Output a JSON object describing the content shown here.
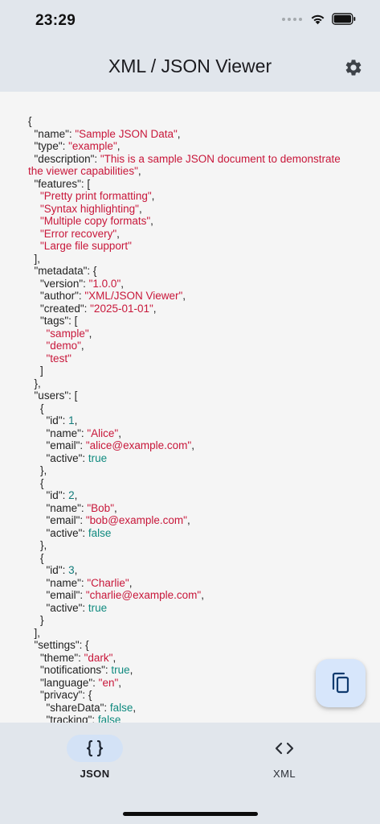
{
  "status_bar": {
    "time": "23:29"
  },
  "app_bar": {
    "title": "XML / JSON Viewer",
    "settings_icon": "gear-icon"
  },
  "json_lines": [
    [
      {
        "t": "p",
        "v": "{"
      }
    ],
    [
      {
        "t": "p",
        "v": "  \"name\": "
      },
      {
        "t": "s",
        "v": "\"Sample JSON Data\""
      },
      {
        "t": "p",
        "v": ","
      }
    ],
    [
      {
        "t": "p",
        "v": "  \"type\": "
      },
      {
        "t": "s",
        "v": "\"example\""
      },
      {
        "t": "p",
        "v": ","
      }
    ],
    [
      {
        "t": "p",
        "v": "  \"description\": "
      },
      {
        "t": "s",
        "v": "\"This is a sample JSON document to demonstrate the viewer capabilities\""
      },
      {
        "t": "p",
        "v": ","
      }
    ],
    [
      {
        "t": "p",
        "v": "  \"features\": ["
      }
    ],
    [
      {
        "t": "p",
        "v": "    "
      },
      {
        "t": "s",
        "v": "\"Pretty print formatting\""
      },
      {
        "t": "p",
        "v": ","
      }
    ],
    [
      {
        "t": "p",
        "v": "    "
      },
      {
        "t": "s",
        "v": "\"Syntax highlighting\""
      },
      {
        "t": "p",
        "v": ","
      }
    ],
    [
      {
        "t": "p",
        "v": "    "
      },
      {
        "t": "s",
        "v": "\"Multiple copy formats\""
      },
      {
        "t": "p",
        "v": ","
      }
    ],
    [
      {
        "t": "p",
        "v": "    "
      },
      {
        "t": "s",
        "v": "\"Error recovery\""
      },
      {
        "t": "p",
        "v": ","
      }
    ],
    [
      {
        "t": "p",
        "v": "    "
      },
      {
        "t": "s",
        "v": "\"Large file support\""
      }
    ],
    [
      {
        "t": "p",
        "v": "  ],"
      }
    ],
    [
      {
        "t": "p",
        "v": "  \"metadata\": {"
      }
    ],
    [
      {
        "t": "p",
        "v": "    \"version\": "
      },
      {
        "t": "s",
        "v": "\"1.0.0\""
      },
      {
        "t": "p",
        "v": ","
      }
    ],
    [
      {
        "t": "p",
        "v": "    \"author\": "
      },
      {
        "t": "s",
        "v": "\"XML/JSON Viewer\""
      },
      {
        "t": "p",
        "v": ","
      }
    ],
    [
      {
        "t": "p",
        "v": "    \"created\": "
      },
      {
        "t": "s",
        "v": "\"2025-01-01\""
      },
      {
        "t": "p",
        "v": ","
      }
    ],
    [
      {
        "t": "p",
        "v": "    \"tags\": ["
      }
    ],
    [
      {
        "t": "p",
        "v": "      "
      },
      {
        "t": "s",
        "v": "\"sample\""
      },
      {
        "t": "p",
        "v": ","
      }
    ],
    [
      {
        "t": "p",
        "v": "      "
      },
      {
        "t": "s",
        "v": "\"demo\""
      },
      {
        "t": "p",
        "v": ","
      }
    ],
    [
      {
        "t": "p",
        "v": "      "
      },
      {
        "t": "s",
        "v": "\"test\""
      }
    ],
    [
      {
        "t": "p",
        "v": "    ]"
      }
    ],
    [
      {
        "t": "p",
        "v": "  },"
      }
    ],
    [
      {
        "t": "p",
        "v": "  \"users\": ["
      }
    ],
    [
      {
        "t": "p",
        "v": "    {"
      }
    ],
    [
      {
        "t": "p",
        "v": "      \"id\": "
      },
      {
        "t": "n",
        "v": "1"
      },
      {
        "t": "p",
        "v": ","
      }
    ],
    [
      {
        "t": "p",
        "v": "      \"name\": "
      },
      {
        "t": "s",
        "v": "\"Alice\""
      },
      {
        "t": "p",
        "v": ","
      }
    ],
    [
      {
        "t": "p",
        "v": "      \"email\": "
      },
      {
        "t": "s",
        "v": "\"alice@example.com\""
      },
      {
        "t": "p",
        "v": ","
      }
    ],
    [
      {
        "t": "p",
        "v": "      \"active\": "
      },
      {
        "t": "b",
        "v": "true"
      }
    ],
    [
      {
        "t": "p",
        "v": "    },"
      }
    ],
    [
      {
        "t": "p",
        "v": "    {"
      }
    ],
    [
      {
        "t": "p",
        "v": "      \"id\": "
      },
      {
        "t": "n",
        "v": "2"
      },
      {
        "t": "p",
        "v": ","
      }
    ],
    [
      {
        "t": "p",
        "v": "      \"name\": "
      },
      {
        "t": "s",
        "v": "\"Bob\""
      },
      {
        "t": "p",
        "v": ","
      }
    ],
    [
      {
        "t": "p",
        "v": "      \"email\": "
      },
      {
        "t": "s",
        "v": "\"bob@example.com\""
      },
      {
        "t": "p",
        "v": ","
      }
    ],
    [
      {
        "t": "p",
        "v": "      \"active\": "
      },
      {
        "t": "b",
        "v": "false"
      }
    ],
    [
      {
        "t": "p",
        "v": "    },"
      }
    ],
    [
      {
        "t": "p",
        "v": "    {"
      }
    ],
    [
      {
        "t": "p",
        "v": "      \"id\": "
      },
      {
        "t": "n",
        "v": "3"
      },
      {
        "t": "p",
        "v": ","
      }
    ],
    [
      {
        "t": "p",
        "v": "      \"name\": "
      },
      {
        "t": "s",
        "v": "\"Charlie\""
      },
      {
        "t": "p",
        "v": ","
      }
    ],
    [
      {
        "t": "p",
        "v": "      \"email\": "
      },
      {
        "t": "s",
        "v": "\"charlie@example.com\""
      },
      {
        "t": "p",
        "v": ","
      }
    ],
    [
      {
        "t": "p",
        "v": "      \"active\": "
      },
      {
        "t": "b",
        "v": "true"
      }
    ],
    [
      {
        "t": "p",
        "v": "    }"
      }
    ],
    [
      {
        "t": "p",
        "v": "  ],"
      }
    ],
    [
      {
        "t": "p",
        "v": "  \"settings\": {"
      }
    ],
    [
      {
        "t": "p",
        "v": "    \"theme\": "
      },
      {
        "t": "s",
        "v": "\"dark\""
      },
      {
        "t": "p",
        "v": ","
      }
    ],
    [
      {
        "t": "p",
        "v": "    \"notifications\": "
      },
      {
        "t": "b",
        "v": "true"
      },
      {
        "t": "p",
        "v": ","
      }
    ],
    [
      {
        "t": "p",
        "v": "    \"language\": "
      },
      {
        "t": "s",
        "v": "\"en\""
      },
      {
        "t": "p",
        "v": ","
      }
    ],
    [
      {
        "t": "p",
        "v": "    \"privacy\": {"
      }
    ],
    [
      {
        "t": "p",
        "v": "      \"shareData\": "
      },
      {
        "t": "b",
        "v": "false"
      },
      {
        "t": "p",
        "v": ","
      }
    ],
    [
      {
        "t": "p",
        "v": "      \"tracking\": "
      },
      {
        "t": "b",
        "v": "false"
      }
    ]
  ],
  "fab": {
    "icon": "copy-icon"
  },
  "bottom_nav": {
    "items": [
      {
        "label": "JSON",
        "icon": "braces-icon",
        "selected": true
      },
      {
        "label": "XML",
        "icon": "code-icon",
        "selected": false
      }
    ]
  },
  "colors": {
    "string": "#c8173a",
    "number": "#0f7a79",
    "boolean": "#0f8a7f",
    "bar_background": "#e1e6ec",
    "selected_pill": "#d3e2f6",
    "fab_background": "#d7e6fb"
  }
}
